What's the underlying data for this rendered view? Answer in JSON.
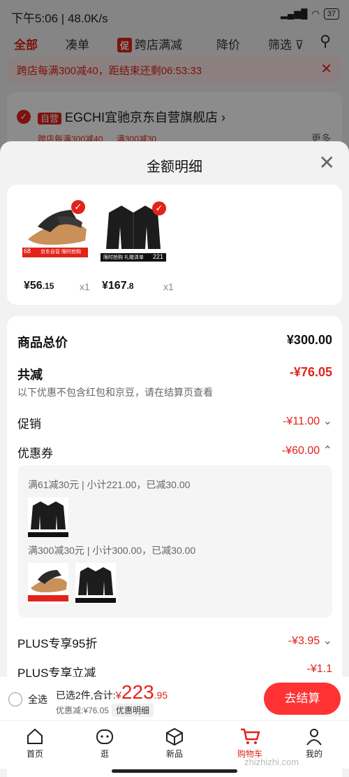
{
  "status": {
    "time": "下午5:06 | 48.0K/s",
    "battery": "37"
  },
  "filters": {
    "all": "全部",
    "combine": "凑单",
    "promo_tag": "促",
    "cross_store": "跨店满减",
    "price_drop": "降价",
    "filter": "筛选"
  },
  "banner": {
    "text": "跨店每满300减40，距结束还剩06:53:33"
  },
  "store": {
    "badge": "自营",
    "name": "EGCHI宜驰京东自营旗舰店",
    "tag1": "跨店每满300减40",
    "tag2": "满300减30",
    "more": "更多"
  },
  "sheet": {
    "title": "金额明细",
    "products": [
      {
        "price_int": "¥56",
        "price_dec": ".15",
        "qty": "x1",
        "badge_num": "68",
        "badge_text": "京东自营 限时抢购"
      },
      {
        "price_int": "¥167",
        "price_dec": ".8",
        "qty": "x1",
        "badge_num": "221",
        "badge_text": "限时抢购 礼赠清单"
      }
    ],
    "total_label": "商品总价",
    "total_value": "¥300.00",
    "reduce_label": "共减",
    "reduce_value": "-¥76.05",
    "reduce_note": "以下优惠不包含红包和京豆，请在结算页查看",
    "promo_label": "促销",
    "promo_value": "-¥11.00",
    "coupon_label": "优惠券",
    "coupon_value": "-¥60.00",
    "coupon_line1": "满61减30元 | 小计221.00，已减30.00",
    "coupon_line2": "满300减30元 | 小计300.00，已减30.00",
    "plus95_label": "PLUS专享95折",
    "plus95_value": "-¥3.95",
    "plus_reduce_label": "PLUS专享立减",
    "plus_reduce_value": "-¥1.1"
  },
  "bottom": {
    "select_all": "全选",
    "selected": "已选2件,合计:",
    "cur": "¥",
    "amount_int": "223",
    "amount_dec": ".95",
    "discount": "优惠减:¥76.05",
    "detail_chip": "优惠明细",
    "checkout": "去结算"
  },
  "tabs": [
    "首页",
    "逛",
    "新品",
    "购物车",
    "我的"
  ],
  "watermark": "zhizhizhi.com",
  "colors": {
    "accent": "#e2231a",
    "checkout": "#ff3333"
  }
}
